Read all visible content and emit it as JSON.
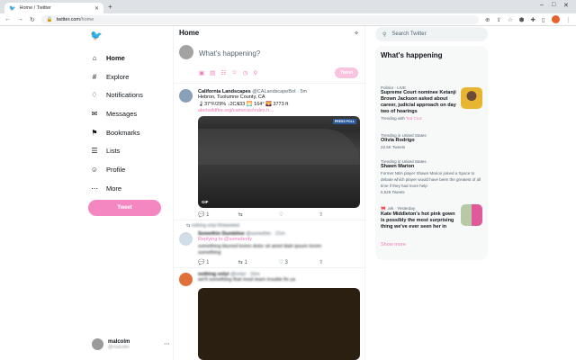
{
  "browser": {
    "tab_title": "Home / Twitter",
    "new_tab": "+",
    "url_domain": "twitter.com",
    "url_path": "/home"
  },
  "sidebar": {
    "items": [
      {
        "label": "Home",
        "icon": "home-icon",
        "glyph": "⌂"
      },
      {
        "label": "Explore",
        "icon": "hashtag-icon",
        "glyph": "#"
      },
      {
        "label": "Notifications",
        "icon": "bell-icon",
        "glyph": "♢"
      },
      {
        "label": "Messages",
        "icon": "envelope-icon",
        "glyph": "✉"
      },
      {
        "label": "Bookmarks",
        "icon": "bookmark-icon",
        "glyph": "⚑"
      },
      {
        "label": "Lists",
        "icon": "list-icon",
        "glyph": "☰"
      },
      {
        "label": "Profile",
        "icon": "person-icon",
        "glyph": "☺"
      },
      {
        "label": "More",
        "icon": "more-circle-icon",
        "glyph": "⋯"
      }
    ],
    "tweet_button": "Tweet",
    "account": {
      "name": "malcolm",
      "handle": "@malcolm"
    }
  },
  "main": {
    "title": "Home",
    "compose_placeholder": "What's happening?",
    "compose_button": "Tweet",
    "tweets": [
      {
        "name": "California Landscapes",
        "meta": "@CALandscapeBot · 5m",
        "line1": "Hebron, Tuolumne County, CA",
        "line2": "🌡37°F/29% ↓2C/ℹ33 🌅 164° 🌄 3773 ft",
        "link": "alertwildfire.org/cameras/index.h...",
        "image_badge": "PRESS POLL",
        "image_tag": "GIF",
        "reply_count": "1",
        "retweet_count": "",
        "like_count": ""
      },
      {
        "retweeted_by": "nothing onlyi Retweeted",
        "name": "Somethin Dumbline",
        "meta": "@somethin · 21m",
        "replying_to": "Replying to @somebody",
        "line1": "something blurred lorem dolor sit amet blah ipsum lorem",
        "line2": "something",
        "reply_count": "1",
        "retweet_count": "1",
        "like_count": "3"
      },
      {
        "name": "nothing onlyi",
        "meta": "@onlyi · 16m",
        "line1": "we'll something that most learn trouble.fix ya"
      }
    ]
  },
  "right": {
    "search_placeholder": "Search Twitter",
    "trends_title": "What's happening",
    "trends": [
      {
        "context": "Politics · LIVE",
        "title": "Supreme Court nominee Ketanji Brown Jackson asked about career, judicial approach on day two of hearings",
        "sub_prefix": "Trending with",
        "sub_link": "Ted Cruz",
        "has_thumb": true
      },
      {
        "context": "Trending in United States",
        "title": "Olivia Rodrigo",
        "sub": "22.5K Tweets"
      },
      {
        "context": "Trending in United States",
        "title": "Shawn Marion",
        "sub": "Former NBA player Shawn Marion joined a Space to debate which player would have been the greatest of all time if they had more help",
        "sub2": "5,625 Tweets"
      },
      {
        "context": "🎀 .ark · Yesterday",
        "title": "Kate Middleton's hot pink gown is possibly the most surprising thing we've ever seen her in",
        "has_thumb": true
      }
    ],
    "show_more": "Show more"
  },
  "colors": {
    "accent": "#1d9bf0",
    "pink": "#f07ab8",
    "tweet_button": "#f487c2"
  }
}
